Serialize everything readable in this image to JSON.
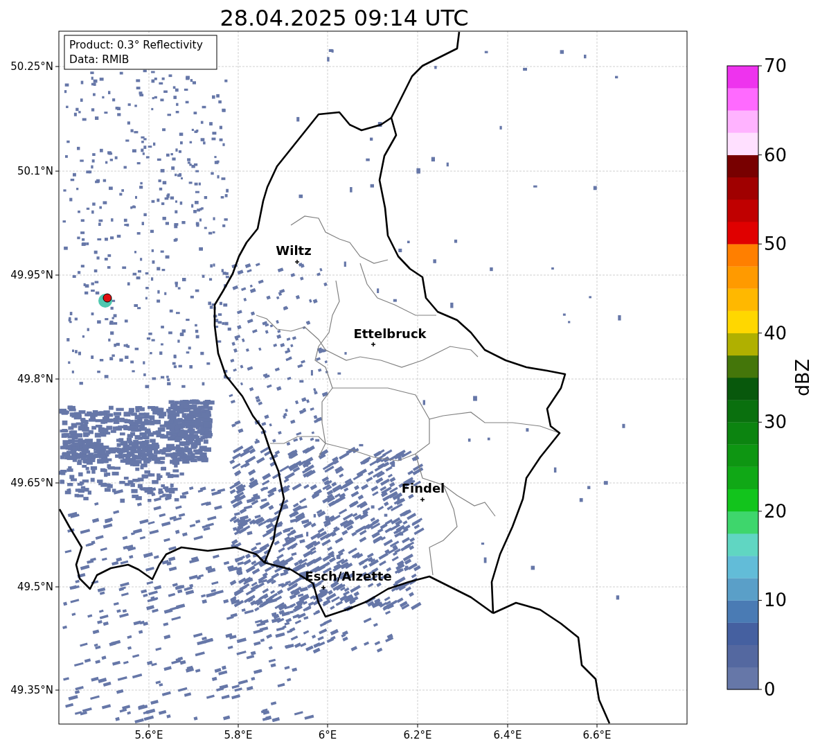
{
  "title": "28.04.2025 09:14 UTC",
  "info_box": {
    "lines": [
      "Product: 0.3° Reflectivity",
      "Data: RMIB"
    ]
  },
  "map": {
    "x_ticks": [
      "5.6°E",
      "5.8°E",
      "6°E",
      "6.2°E",
      "6.4°E",
      "6.6°E"
    ],
    "y_ticks": [
      "50.25°N",
      "50.1°N",
      "49.95°N",
      "49.8°N",
      "49.65°N",
      "49.5°N",
      "49.35°N"
    ],
    "places": [
      {
        "name": "Wiltz"
      },
      {
        "name": "Ettelbruck"
      },
      {
        "name": "Findel"
      },
      {
        "name": "Esch/Alzette"
      }
    ]
  },
  "colorbar": {
    "label": "dBZ",
    "ticks": [
      "70",
      "60",
      "50",
      "40",
      "30",
      "20",
      "10",
      "0"
    ],
    "segments": [
      {
        "color": "#6677a8"
      },
      {
        "color": "#5468a0"
      },
      {
        "color": "#4560a0"
      },
      {
        "color": "#4a7bb4"
      },
      {
        "color": "#5a9fc8"
      },
      {
        "color": "#62bcd8"
      },
      {
        "color": "#60d6c2"
      },
      {
        "color": "#3ed66c"
      },
      {
        "color": "#12c41c"
      },
      {
        "color": "#10a816"
      },
      {
        "color": "#0e9612"
      },
      {
        "color": "#0c8410"
      },
      {
        "color": "#0a700e"
      },
      {
        "color": "#08580c"
      },
      {
        "color": "#44760a"
      },
      {
        "color": "#b0b000"
      },
      {
        "color": "#ffd700"
      },
      {
        "color": "#ffb800"
      },
      {
        "color": "#ff9a00"
      },
      {
        "color": "#ff7f00"
      },
      {
        "color": "#e00000"
      },
      {
        "color": "#c00000"
      },
      {
        "color": "#a00000"
      },
      {
        "color": "#780000"
      },
      {
        "color": "#ffe0ff"
      },
      {
        "color": "#ffb3ff"
      },
      {
        "color": "#ff6aff"
      },
      {
        "color": "#ee33ee"
      }
    ]
  }
}
